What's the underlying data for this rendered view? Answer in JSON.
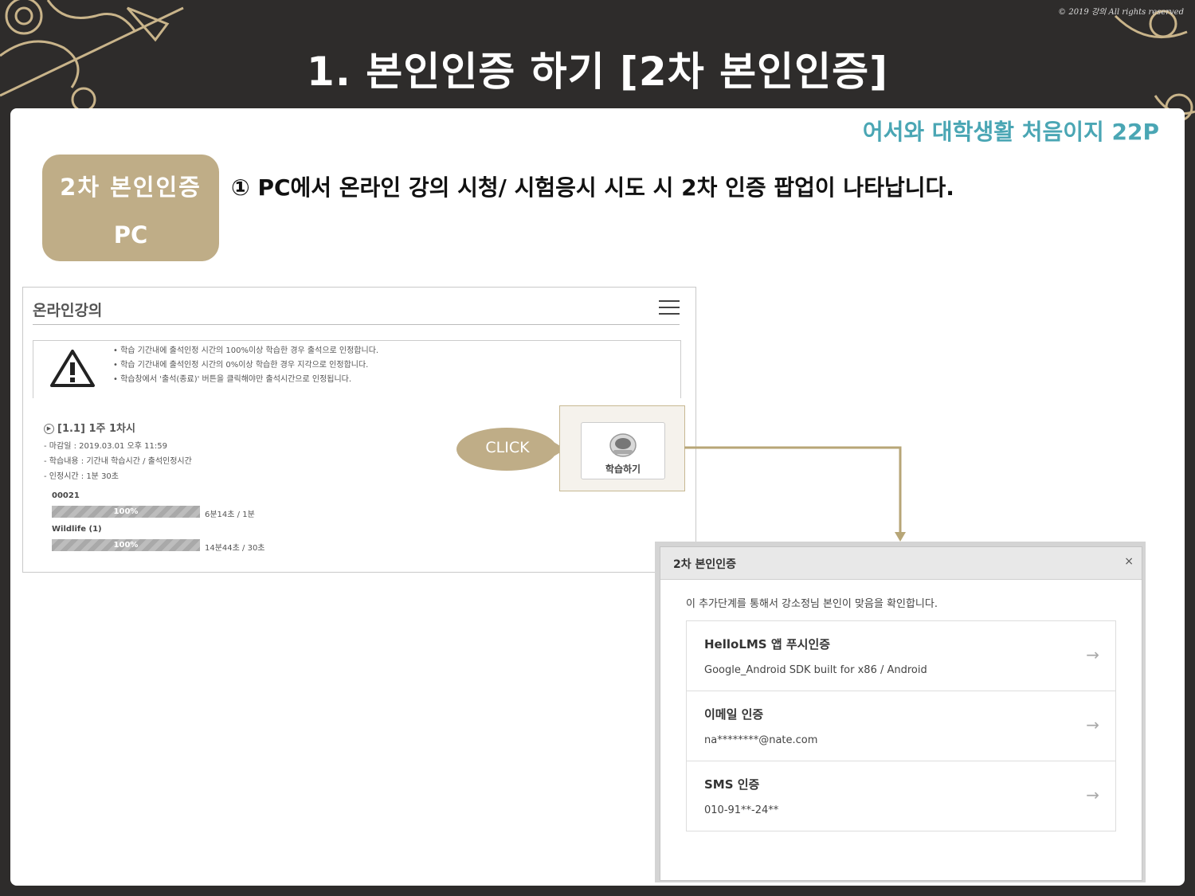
{
  "header": {
    "copyright": "© 2019 강의 All rights reserved",
    "title": "1. 본인인증 하기 [2차 본인인증]"
  },
  "card": {
    "source_ref": "어서와 대학생활 처음이지 22P",
    "badge": {
      "line1": "2차 본인인증",
      "line2": "PC"
    },
    "step_text": "① PC에서 온라인 강의 시청/ 시험응시 시도 시 2차 인증 팝업이 나타납니다."
  },
  "lecture_panel": {
    "title": "온라인강의",
    "notices": [
      "학습 기간내에 출석인정 시간의 100%이상 학습한 경우 출석으로 인정합니다.",
      "학습 기간내에 출석인정 시간의 0%이상 학습한 경우 지각으로 인정합니다.",
      "학습창에서 '출석(종료)' 버튼을 클릭해야만 출석시간으로 인정됩니다."
    ],
    "lesson_title": "[1.1] 1주 1차시",
    "meta": [
      "마감일 : 2019.03.01 오후 11:59",
      "학습내용 : 기간내 학습시간 / 출석인정시간",
      "인정시간 : 1분 30초"
    ],
    "progress": [
      {
        "label": "00021",
        "percent": "100%",
        "time": "6분14초 / 1분"
      },
      {
        "label": "Wildlife (1)",
        "percent": "100%",
        "time": "14분44초 / 30초"
      }
    ]
  },
  "click_bubble": "CLICK",
  "study_button": "학습하기",
  "popup": {
    "title": "2차 본인인증",
    "close": "×",
    "description": "이 추가단계를 통해서 강소정님 본인이 맞음을 확인합니다.",
    "options": [
      {
        "title": "HelloLMS 앱 푸시인증",
        "subtitle": "Google_Android SDK built for x86 / Android"
      },
      {
        "title": "이메일 인증",
        "subtitle": "na********@nate.com"
      },
      {
        "title": "SMS 인증",
        "subtitle": "010-91**-24**"
      }
    ],
    "arrow": "→"
  },
  "colors": {
    "background": "#2e2c2b",
    "badge": "#bfad87",
    "accent_teal": "#4aa6b4",
    "connector": "#b7a677"
  }
}
